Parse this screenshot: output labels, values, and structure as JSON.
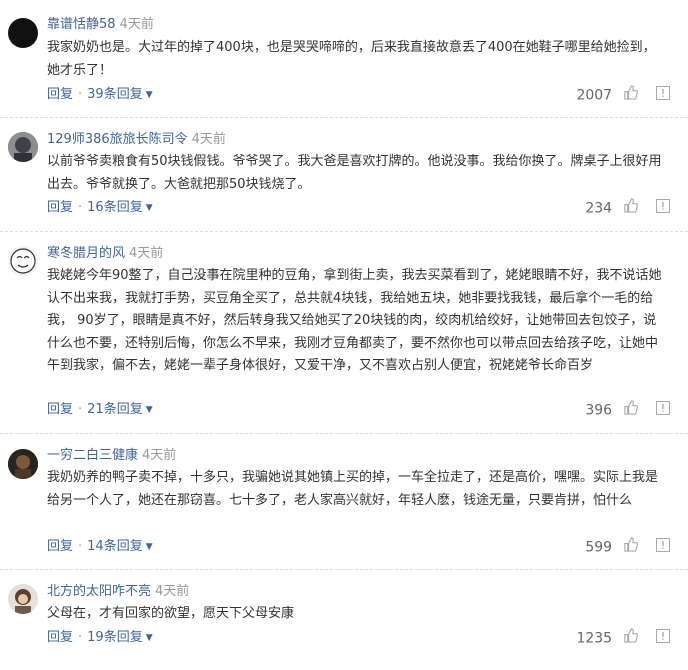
{
  "comments": [
    {
      "username": "靠谱恬静58",
      "time": "4天前",
      "text": "我家奶奶也是。大过年的掉了400块，也是哭哭啼啼的，后来我直接故意丢了400在她鞋子哪里给她捡到，她才乐了！",
      "reply_label": "回复",
      "replies_label": "39条回复",
      "likes": "2007"
    },
    {
      "username": "129师386旅旅长陈司令",
      "time": "4天前",
      "text": "以前爷爷卖粮食有50块钱假钱。爷爷哭了。我大爸是喜欢打牌的。他说没事。我给你换了。牌桌子上很好用出去。爷爷就换了。大爸就把那50块钱烧了。",
      "reply_label": "回复",
      "replies_label": "16条回复",
      "likes": "234"
    },
    {
      "username": "寒冬腊月的风",
      "time": "4天前",
      "text": "我姥姥今年90整了，自己没事在院里种的豆角，拿到街上卖，我去买菜看到了，姥姥眼睛不好，我不说话她认不出来我，我就打手势，买豆角全买了，总共就4块钱，我给她五块，她非要找我钱，最后拿个一毛的给我， 90岁了，眼睛是真不好，然后转身我又给她买了20块钱的肉，绞肉机给绞好，让她带回去包饺子，说什么也不要，还特别后悔，你怎么不早来，我刚才豆角都卖了，要不然你也可以带点回去给孩子吃，让她中午到我家，偏不去，姥姥一辈子身体很好，又爱干净，又不喜欢占别人便宜，祝姥姥爷长命百岁",
      "reply_label": "回复",
      "replies_label": "21条回复",
      "likes": "396"
    },
    {
      "username": "一穷二白三健康",
      "time": "4天前",
      "text": "我奶奶养的鸭子卖不掉，十多只，我骗她说其她镇上买的掉，一车全拉走了，还是高价，嘿嘿。实际上我是给另一个人了，她还在那窃喜。七十多了，老人家高兴就好，年轻人麽，钱途无量，只要肯拼，怕什么",
      "reply_label": "回复",
      "replies_label": "14条回复",
      "likes": "599"
    },
    {
      "username": "北方的太阳咋不亮",
      "time": "4天前",
      "text": "父母在，才有回家的欲望，愿天下父母安康",
      "reply_label": "回复",
      "replies_label": "19条回复",
      "likes": "1235"
    }
  ],
  "icons": {
    "like": "thumbs-up-icon",
    "report": "report-icon"
  },
  "colors": {
    "username": "#406599",
    "text": "#333333",
    "meta": "#999999"
  }
}
